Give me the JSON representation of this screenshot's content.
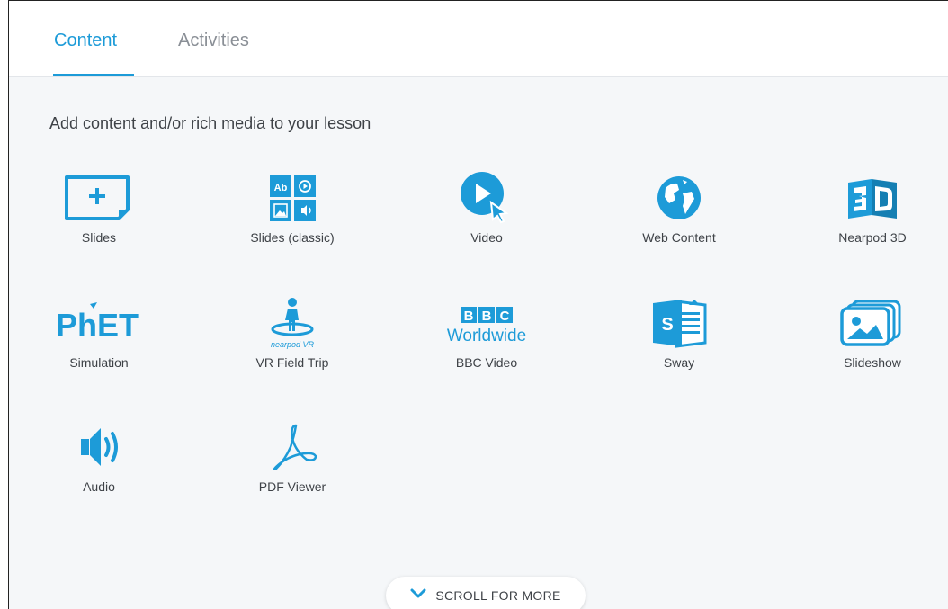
{
  "tabs": [
    {
      "label": "Content",
      "active": true
    },
    {
      "label": "Activities",
      "active": false
    }
  ],
  "heading": "Add content and/or rich media to your lesson",
  "items": [
    {
      "label": "Slides",
      "icon": "slides-icon"
    },
    {
      "label": "Slides (classic)",
      "icon": "slides-classic-icon"
    },
    {
      "label": "Video",
      "icon": "video-icon"
    },
    {
      "label": "Web Content",
      "icon": "globe-icon"
    },
    {
      "label": "Nearpod 3D",
      "icon": "nearpod-3d-icon"
    },
    {
      "label": "Simulation",
      "icon": "phet-logo-icon",
      "logo_text": "PhET"
    },
    {
      "label": "VR Field Trip",
      "icon": "vr-field-trip-icon",
      "logo_text": "nearpod VR"
    },
    {
      "label": "BBC Video",
      "icon": "bbc-worldwide-logo-icon",
      "logo_text": "BBC Worldwide"
    },
    {
      "label": "Sway",
      "icon": "sway-icon",
      "logo_text": "S"
    },
    {
      "label": "Slideshow",
      "icon": "slideshow-icon"
    },
    {
      "label": "Audio",
      "icon": "speaker-icon"
    },
    {
      "label": "PDF Viewer",
      "icon": "pdf-icon"
    }
  ],
  "scroll_more": {
    "label": "SCROLL FOR MORE",
    "icon": "chevron-down-icon"
  },
  "colors": {
    "accent": "#1d9bd8",
    "inactive_tab": "#8a8f96",
    "background": "#f5f7f9"
  }
}
